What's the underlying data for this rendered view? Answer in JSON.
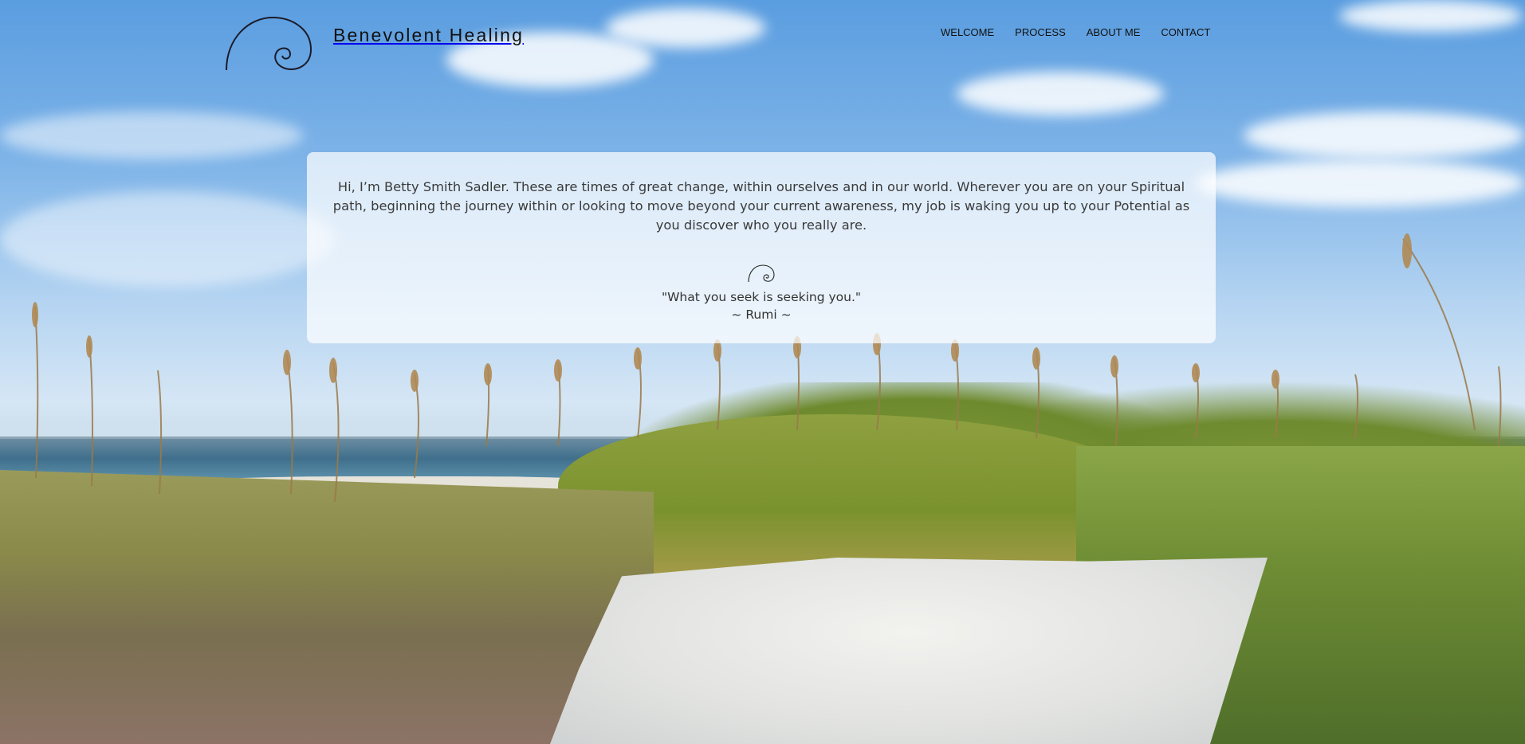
{
  "site": {
    "brand_name": "Benevolent Healing",
    "logo_icon": "spiral-logo-icon"
  },
  "nav": {
    "items": [
      {
        "label": "WELCOME"
      },
      {
        "label": "PROCESS"
      },
      {
        "label": "ABOUT ME"
      },
      {
        "label": "CONTACT"
      }
    ]
  },
  "intro": {
    "text": "Hi, I’m Betty Smith Sadler. These are times of great change, within ourselves and in our world. Wherever you are on your Spiritual path, beginning the journey within or looking to move beyond your current awareness, my job is waking you up to your Potential as you discover who you really are.",
    "divider_icon": "spiral-icon",
    "quote": "\"What you seek is seeking you.\"",
    "quote_author": "~ Rumi ~"
  },
  "colors": {
    "sky": "#6aa6e3",
    "text_dark": "#111111",
    "card_bg": "#ffffff"
  }
}
